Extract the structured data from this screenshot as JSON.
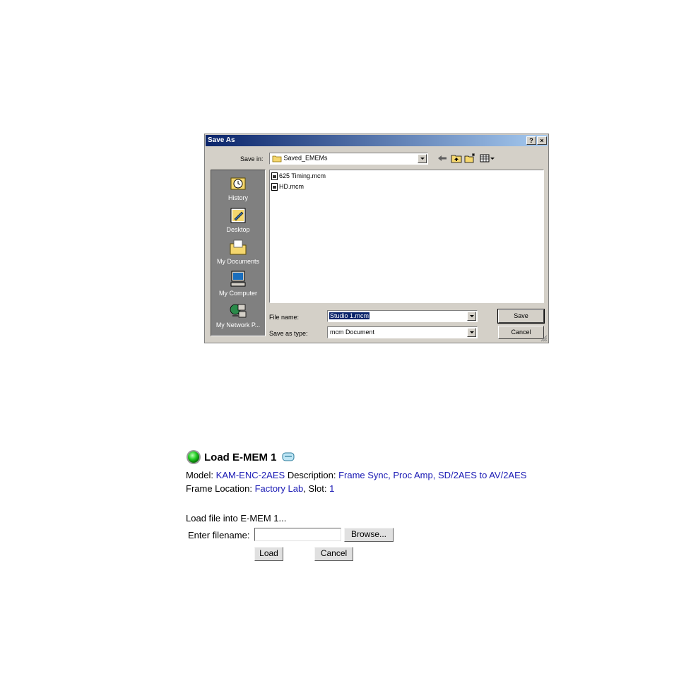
{
  "dialog": {
    "title": "Save As",
    "help_button": "?",
    "close_button": "×",
    "save_in_label": "Save in:",
    "save_in_value": "Saved_EMEMs",
    "toolbar_icons": [
      "back-icon",
      "up-folder-icon",
      "new-folder-icon",
      "view-menu-icon"
    ],
    "places": [
      {
        "label": "History",
        "icon": "history-icon"
      },
      {
        "label": "Desktop",
        "icon": "desktop-icon"
      },
      {
        "label": "My Documents",
        "icon": "my-documents-icon"
      },
      {
        "label": "My Computer",
        "icon": "my-computer-icon"
      },
      {
        "label": "My Network P...",
        "icon": "my-network-places-icon"
      }
    ],
    "files": [
      "625 Timing.mcm",
      "HD.mcm"
    ],
    "file_name_label": "File name:",
    "file_name_value": "Studio 1.mcm",
    "save_as_type_label": "Save as type:",
    "save_as_type_value": "mcm Document",
    "save_button": "Save",
    "cancel_button": "Cancel"
  },
  "panel": {
    "title": "Load E-MEM 1",
    "status_color": "#22cc22",
    "model_label": "Model:",
    "model_value": "KAM-ENC-2AES",
    "description_label": "Description:",
    "description_value": "Frame Sync, Proc Amp, SD/2AES to AV/2AES",
    "frame_location_label": "Frame Location:",
    "frame_location_value": "Factory Lab",
    "slot_label": ", Slot:",
    "slot_value": "1",
    "load_prompt": "Load file into E-MEM 1...",
    "filename_label": "Enter filename:",
    "filename_value": "",
    "browse_button": "Browse...",
    "load_button": "Load",
    "cancel_button": "Cancel"
  }
}
